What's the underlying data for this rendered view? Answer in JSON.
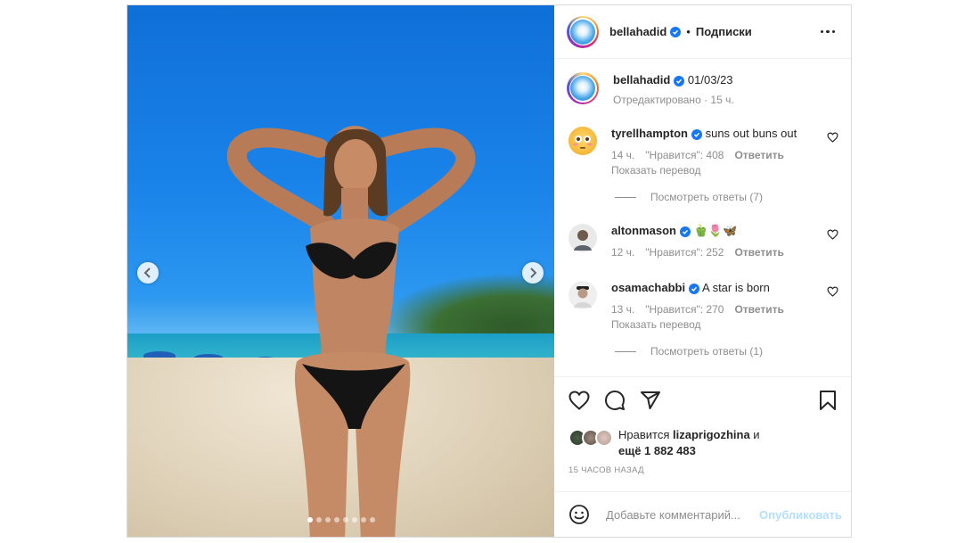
{
  "post": {
    "author": "bellahadid",
    "follow_label": "Подписки",
    "bullet": "•",
    "carousel_dot_count": 8,
    "carousel_active_index": 0
  },
  "caption": {
    "username": "bellahadid",
    "text": "01/03/23",
    "meta": "Отредактировано · 15 ч."
  },
  "comments": [
    {
      "username": "tyrellhampton",
      "text": "suns out buns out",
      "time": "14 ч.",
      "likes": "\"Нравится\": 408",
      "reply": "Ответить",
      "translate": "Показать перевод",
      "view_replies": "Посмотреть ответы (7)"
    },
    {
      "username": "altonmason",
      "text": "🫑🌷🦋",
      "time": "12 ч.",
      "likes": "\"Нравится\": 252",
      "reply": "Ответить"
    },
    {
      "username": "osamachabbi",
      "text": "A star is born",
      "time": "13 ч.",
      "likes": "\"Нравится\": 270",
      "reply": "Ответить",
      "translate": "Показать перевод",
      "view_replies": "Посмотреть ответы (1)"
    }
  ],
  "likes": {
    "prefix": "Нравится",
    "user": "lizaprigozhina",
    "and": "и",
    "more": "ещё 1 882 483"
  },
  "time_ago": "15 ЧАСОВ НАЗАД",
  "comment_box": {
    "placeholder": "Добавьте комментарий...",
    "publish_label": "Опубликовать"
  },
  "colors": {
    "verified": "#1877f2",
    "publish_disabled": "#b2dffc",
    "secondary_text": "#8e8e8e"
  }
}
